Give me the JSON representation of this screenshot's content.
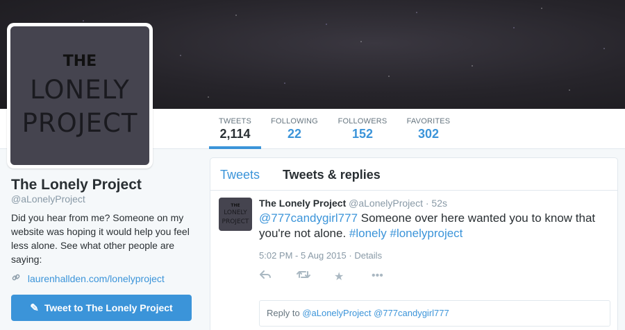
{
  "profile": {
    "name": "The Lonely Project",
    "handle": "@aLonelyProject",
    "bio": "Did you hear from me? Someone on my website was hoping it would help you feel less alone. See what other people are saying:",
    "link": "laurenhallden.com/lonelyproject",
    "tweet_to_label": "Tweet to The Lonely Project",
    "avatar_text": {
      "line1": "THE",
      "line2": "LONELY",
      "line3": "PROJECT"
    }
  },
  "stats": [
    {
      "label": "TWEETS",
      "value": "2,114",
      "active": true
    },
    {
      "label": "FOLLOWING",
      "value": "22"
    },
    {
      "label": "FOLLOWERS",
      "value": "152"
    },
    {
      "label": "FAVORITES",
      "value": "302"
    }
  ],
  "timeline": {
    "tabs": [
      {
        "label": "Tweets",
        "active": true
      },
      {
        "label": "Tweets & replies"
      }
    ],
    "tweet": {
      "name": "The Lonely Project",
      "handle": "@aLonelyProject",
      "separator": " · ",
      "age": "52s",
      "mention": "@777candygirl777",
      "text": " Someone over here wanted you to know that you're not alone. ",
      "hashtag1": "#lonely",
      "hashtag2": "#lonelyproject",
      "timestamp": "5:02 PM - 5 Aug 2015",
      "details_sep": " · ",
      "details": "Details"
    },
    "reply": {
      "prefix": "Reply to ",
      "mentions": "@aLonelyProject @777candygirl777"
    }
  },
  "icons": {
    "link": "link-icon",
    "quill": "compose-quill-icon",
    "reply": "reply-icon",
    "retweet": "retweet-icon",
    "favorite": "star-icon",
    "more": "more-dots-icon"
  },
  "colors": {
    "accent": "#3b94d9",
    "text": "#292f33",
    "muted": "#8899a6"
  }
}
